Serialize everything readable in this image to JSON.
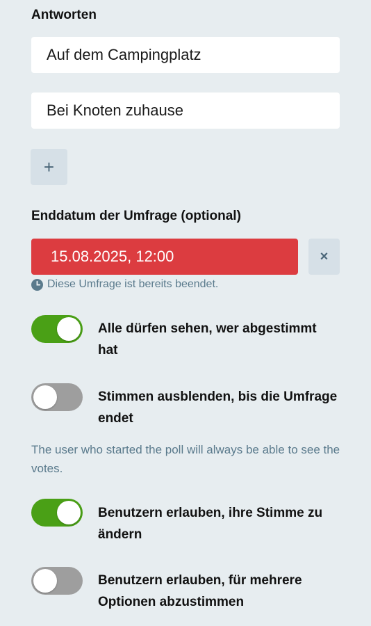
{
  "answers": {
    "title": "Antworten",
    "items": [
      "Auf dem Campingplatz",
      "Bei Knoten zuhause"
    ],
    "add_label": "+"
  },
  "enddate": {
    "title": "Enddatum der Umfrage (optional)",
    "value": "15.08.2025, 12:00",
    "clear_label": "×",
    "notice": "Diese Umfrage ist bereits beendet.",
    "notice_icon": "clock-icon"
  },
  "toggles": [
    {
      "label": "Alle dürfen sehen, wer abgestimmt hat",
      "checked": true
    },
    {
      "label": "Stimmen ausblenden, bis die Umfrage endet",
      "checked": false
    },
    {
      "label": "Benutzern erlauben, ihre Stimme zu ändern",
      "checked": true
    },
    {
      "label": "Benutzern erlauben, für mehrere Optionen abzustimmen",
      "checked": false
    }
  ],
  "help_text": "The user who started the poll will always be able to see the votes.",
  "colors": {
    "background": "#e7edf0",
    "toggle_on": "#4aa016",
    "toggle_off": "#9e9e9e",
    "error": "#dc3c40"
  }
}
